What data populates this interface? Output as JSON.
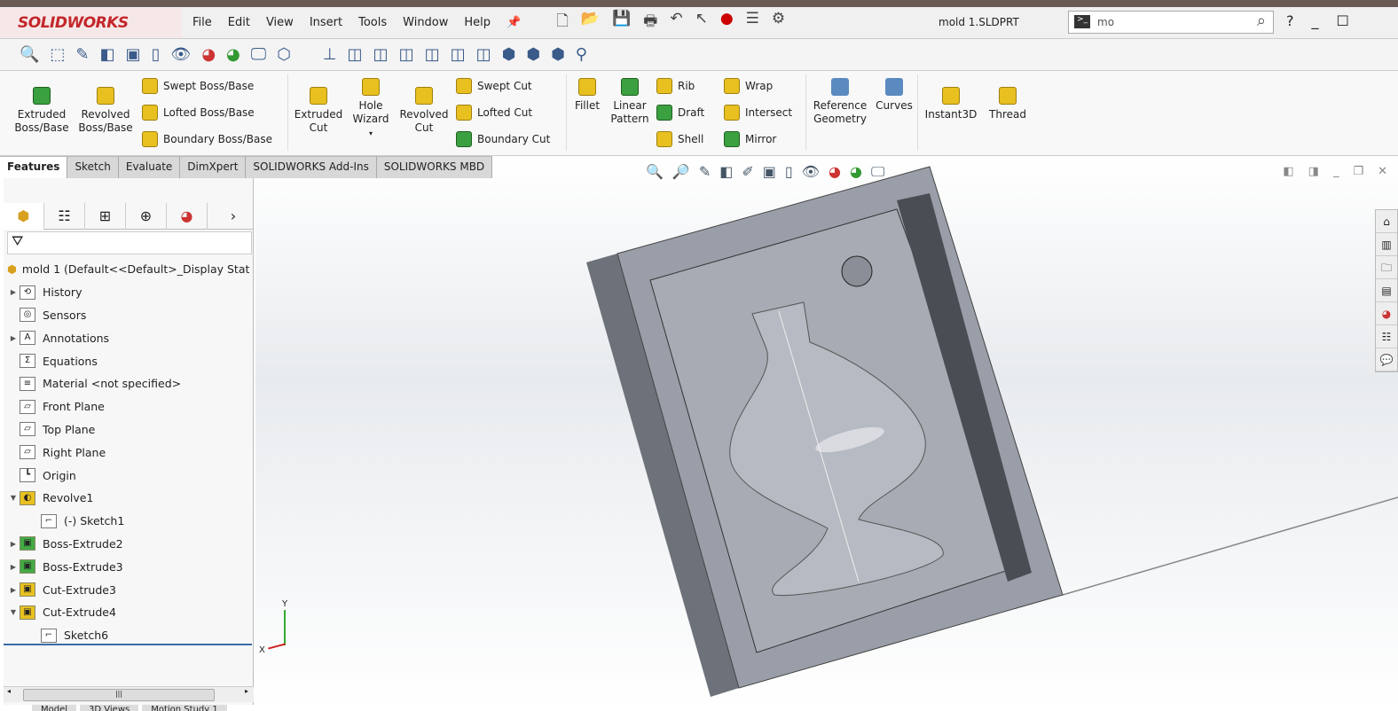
{
  "app": {
    "brand": "SOLIDWORKS",
    "document_title": "mold 1.SLDPRT",
    "search_value": "mo"
  },
  "menu": [
    "File",
    "Edit",
    "View",
    "Insert",
    "Tools",
    "Window",
    "Help"
  ],
  "ribbon": {
    "large": [
      {
        "label": "Extruded Boss/Base"
      },
      {
        "label": "Revolved Boss/Base"
      },
      {
        "label": "Extruded Cut"
      },
      {
        "label": "Hole Wizard"
      },
      {
        "label": "Revolved Cut"
      },
      {
        "label": "Fillet"
      },
      {
        "label": "Linear Pattern"
      },
      {
        "label": "Reference Geometry"
      },
      {
        "label": "Curves"
      },
      {
        "label": "Instant3D"
      },
      {
        "label": "Thread"
      }
    ],
    "small": [
      {
        "label": "Swept Boss/Base"
      },
      {
        "label": "Lofted Boss/Base"
      },
      {
        "label": "Boundary Boss/Base"
      },
      {
        "label": "Swept Cut"
      },
      {
        "label": "Lofted Cut"
      },
      {
        "label": "Boundary Cut"
      },
      {
        "label": "Rib"
      },
      {
        "label": "Draft"
      },
      {
        "label": "Shell"
      },
      {
        "label": "Wrap"
      },
      {
        "label": "Intersect"
      },
      {
        "label": "Mirror"
      }
    ]
  },
  "tabs": [
    {
      "label": "Features",
      "active": true
    },
    {
      "label": "Sketch"
    },
    {
      "label": "Evaluate"
    },
    {
      "label": "DimXpert"
    },
    {
      "label": "SOLIDWORKS Add-Ins"
    },
    {
      "label": "SOLIDWORKS MBD"
    }
  ],
  "tree": {
    "root": "mold 1  (Default<<Default>_Display Stat",
    "items": [
      {
        "label": "History",
        "expand": "right",
        "icon": "history-icon"
      },
      {
        "label": "Sensors",
        "icon": "sensors-icon"
      },
      {
        "label": "Annotations",
        "expand": "right",
        "icon": "annotations-icon"
      },
      {
        "label": "Equations",
        "icon": "equations-icon"
      },
      {
        "label": "Material <not specified>",
        "icon": "material-icon"
      },
      {
        "label": "Front Plane",
        "icon": "plane-icon"
      },
      {
        "label": "Top Plane",
        "icon": "plane-icon"
      },
      {
        "label": "Right Plane",
        "icon": "plane-icon"
      },
      {
        "label": "Origin",
        "icon": "origin-icon"
      },
      {
        "label": "Revolve1",
        "expand": "down",
        "icon": "revolve-icon"
      },
      {
        "label": "(-) Sketch1",
        "indent": true,
        "icon": "sketch-icon"
      },
      {
        "label": "Boss-Extrude2",
        "expand": "right",
        "icon": "boss-extrude-icon"
      },
      {
        "label": "Boss-Extrude3",
        "expand": "right",
        "icon": "boss-extrude-icon"
      },
      {
        "label": "Cut-Extrude3",
        "expand": "right",
        "icon": "cut-extrude-icon"
      },
      {
        "label": "Cut-Extrude4",
        "expand": "down",
        "icon": "cut-extrude-icon"
      },
      {
        "label": "Sketch6",
        "indent": true,
        "icon": "sketch-icon"
      }
    ]
  },
  "bottom_tabs": [
    "Model",
    "3D Views",
    "Motion Study 1"
  ],
  "triad": {
    "x": "X",
    "y": "Y"
  }
}
